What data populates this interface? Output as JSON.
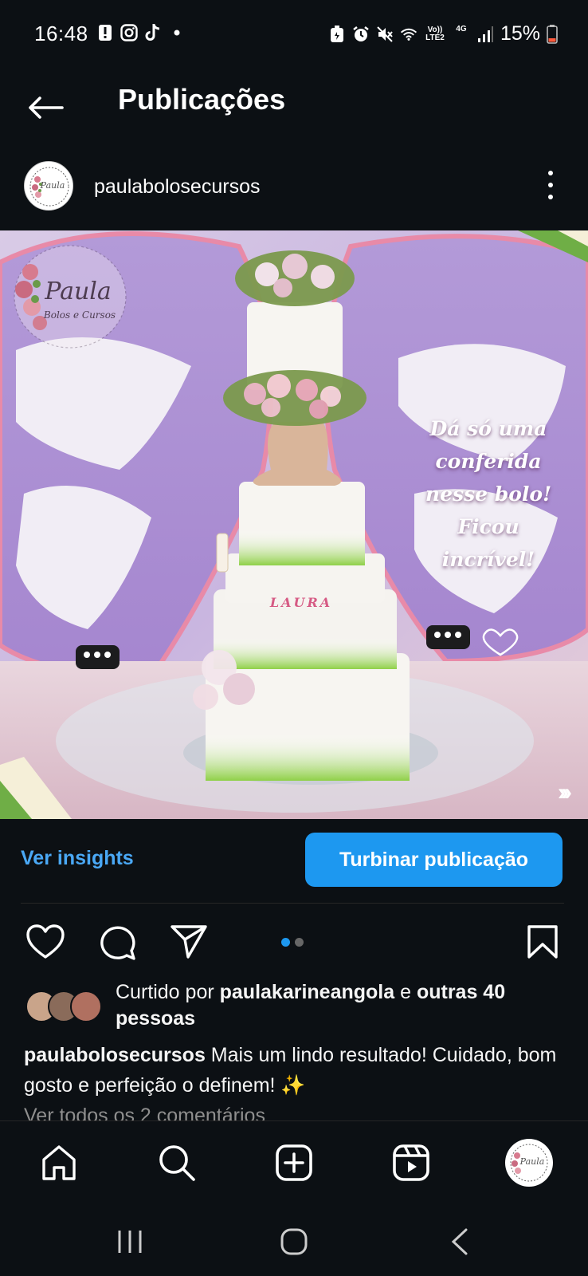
{
  "status_bar": {
    "time": "16:48",
    "left_icons": [
      "alert-icon",
      "instagram-icon",
      "tiktok-icon",
      "dot-icon"
    ],
    "right_icons": [
      "battery-saver-icon",
      "alarm-icon",
      "mute-icon",
      "wifi-icon",
      "volte-icon",
      "4g-icon",
      "signal-icon"
    ],
    "volte_label": "Vo)) LTE2",
    "network_label": "4G",
    "battery": "15%"
  },
  "header": {
    "title": "Publicações"
  },
  "post": {
    "username": "paulabolosecursos",
    "overlay_text": "Dá só uma\nconferida\nnesse bolo!\nFicou\nincrível!",
    "cake_name_label": "LAURA",
    "watermark_line1": "Paula",
    "watermark_line2": "Bolos e Cursos"
  },
  "insights": {
    "link_label": "Ver insights",
    "boost_label": "Turbinar publicação"
  },
  "carousel": {
    "count": 2,
    "active_index": 0
  },
  "likes": {
    "prefix": "Curtido por ",
    "user": "paulakarineangola",
    "middle": " e ",
    "others": "outras 40 pessoas"
  },
  "caption": {
    "username": "paulabolosecursos",
    "text": " Mais um lindo resultado! Cuidado, bom gosto e perfeição o definem! ✨"
  },
  "comments_link": "Ver todos os 2 comentários",
  "colors": {
    "background": "#0c1014",
    "accent_blue": "#1d98f0",
    "link_blue": "#4aa8f5",
    "muted_text": "#8e8e8e"
  }
}
